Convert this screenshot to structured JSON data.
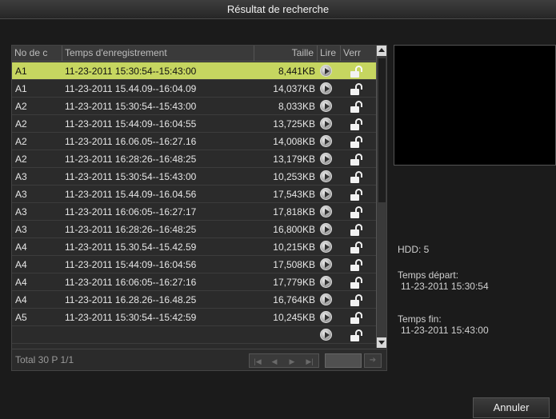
{
  "title": "Résultat de recherche",
  "columns": {
    "no": "No de c",
    "time": "Temps d'enregistrement",
    "size": "Taille",
    "play": "Lire",
    "lock": "Verr"
  },
  "rows": [
    {
      "no": "A1",
      "time": "11-23-2011 15:30:54--15:43:00",
      "size": "8,441KB",
      "selected": true
    },
    {
      "no": "A1",
      "time": "11-23-2011 15.44.09--16:04.09",
      "size": "14,037KB"
    },
    {
      "no": "A2",
      "time": "11-23-2011 15:30:54--15:43:00",
      "size": "8,033KB"
    },
    {
      "no": "A2",
      "time": "11-23-2011 15:44:09--16:04:55",
      "size": "13,725KB"
    },
    {
      "no": "A2",
      "time": "11-23-2011 16.06.05--16:27.16",
      "size": "14,008KB"
    },
    {
      "no": "A2",
      "time": "11-23-2011 16:28:26--16:48:25",
      "size": "13,179KB"
    },
    {
      "no": "A3",
      "time": "11-23-2011 15:30:54--15:43:00",
      "size": "10,253KB"
    },
    {
      "no": "A3",
      "time": "11-23-2011 15.44.09--16.04.56",
      "size": "17,543KB"
    },
    {
      "no": "A3",
      "time": "11-23-2011 16:06:05--16:27:17",
      "size": "17,818KB"
    },
    {
      "no": "A3",
      "time": "11-23-2011 16:28:26--16:48:25",
      "size": "16,800KB"
    },
    {
      "no": "A4",
      "time": "11-23-2011 15.30.54--15.42.59",
      "size": "10,215KB"
    },
    {
      "no": "A4",
      "time": "11-23-2011 15:44:09--16:04:56",
      "size": "17,508KB"
    },
    {
      "no": "A4",
      "time": "11-23-2011 16:06:05--16:27:16",
      "size": "17,779KB"
    },
    {
      "no": "A4",
      "time": "11-23-2011 16.28.26--16.48.25",
      "size": "16,764KB"
    },
    {
      "no": "A5",
      "time": "11-23-2011 15:30:54--15:42:59",
      "size": "10,245KB"
    },
    {
      "no": "",
      "time": "",
      "size": "",
      "partial": true
    }
  ],
  "footer": {
    "total": "Total 30 P 1/1"
  },
  "info": {
    "hdd": "HDD: 5",
    "start_label": "Temps départ:",
    "start_value": "11-23-2011 15:30:54",
    "end_label": "Temps fin:",
    "end_value": "11-23-2011 15:43:00"
  },
  "buttons": {
    "cancel": "Annuler"
  },
  "colors": {
    "selected_row": "#c6d660",
    "background": "#1b1b1b"
  }
}
